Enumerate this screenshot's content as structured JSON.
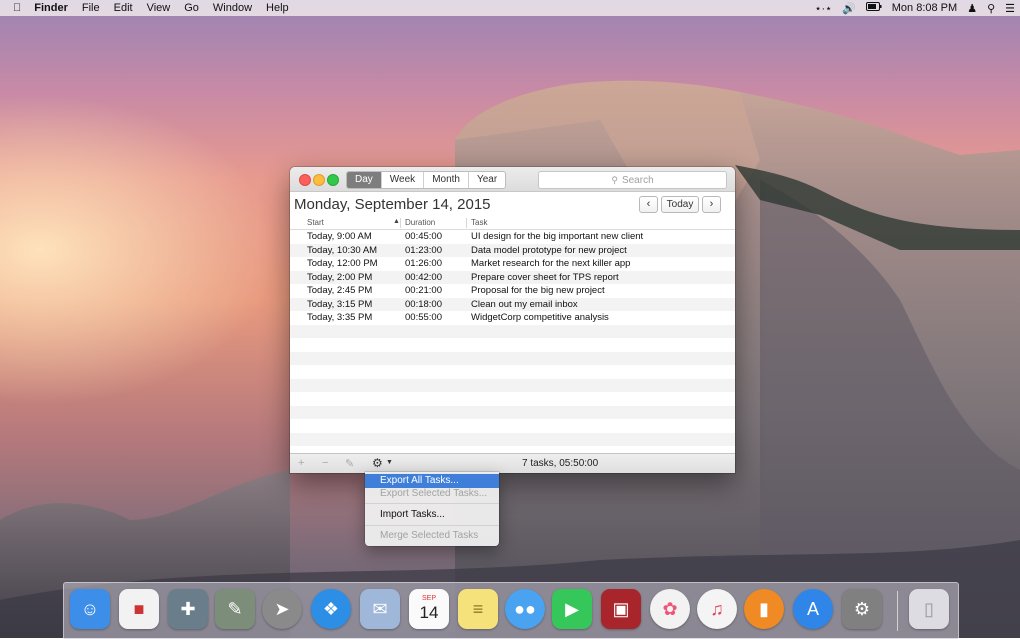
{
  "menubar": {
    "apple": "",
    "app": "Finder",
    "items": [
      "File",
      "Edit",
      "View",
      "Go",
      "Window",
      "Help"
    ],
    "clock": "Mon 8:08 PM",
    "status_icons": [
      "bluetooth-icon",
      "volume-icon",
      "battery-icon",
      "user-icon",
      "spotlight-icon",
      "notification-center-icon"
    ]
  },
  "window": {
    "tabs": [
      {
        "label": "Day",
        "active": true
      },
      {
        "label": "Week",
        "active": false
      },
      {
        "label": "Month",
        "active": false
      },
      {
        "label": "Year",
        "active": false
      }
    ],
    "search_placeholder": "Search",
    "date_title": "Monday, September 14, 2015",
    "today_label": "Today",
    "prev_label": "‹",
    "next_label": "›",
    "columns": {
      "start": "Start",
      "duration": "Duration",
      "task": "Task"
    },
    "rows": [
      {
        "start": "Today, 9:00 AM",
        "duration": "00:45:00",
        "task": "UI design for the big important new client"
      },
      {
        "start": "Today, 10:30 AM",
        "duration": "01:23:00",
        "task": "Data model prototype for new project"
      },
      {
        "start": "Today, 12:00 PM",
        "duration": "01:26:00",
        "task": "Market research for the next killer app"
      },
      {
        "start": "Today, 2:00 PM",
        "duration": "00:42:00",
        "task": "Prepare cover sheet for TPS report"
      },
      {
        "start": "Today, 2:45 PM",
        "duration": "00:21:00",
        "task": "Proposal for the big new project"
      },
      {
        "start": "Today, 3:15 PM",
        "duration": "00:18:00",
        "task": "Clean out my email inbox"
      },
      {
        "start": "Today, 3:35 PM",
        "duration": "00:55:00",
        "task": "WidgetCorp competitive analysis"
      }
    ],
    "status": "7 tasks, 05:50:00"
  },
  "menu": {
    "items": [
      {
        "label": "Export All Tasks...",
        "state": "highlighted"
      },
      {
        "label": "Export Selected Tasks...",
        "state": "disabled"
      },
      {
        "label": "Import Tasks...",
        "state": "enabled"
      },
      {
        "label": "Merge Selected Tasks",
        "state": "disabled"
      }
    ]
  },
  "dock": {
    "apps": [
      {
        "name": "finder-icon",
        "color": "#3d8ee8"
      },
      {
        "name": "calendar-icon",
        "color": "#f2f2f2"
      },
      {
        "name": "app-icon-3",
        "color": "#6a7d8a"
      },
      {
        "name": "app-icon-4",
        "color": "#7c8e7a"
      },
      {
        "name": "launchpad-icon",
        "color": "#8a8a8a"
      },
      {
        "name": "safari-icon",
        "color": "#2d8ee6"
      },
      {
        "name": "mail-icon",
        "color": "#9fb7d8"
      },
      {
        "name": "calendar-14-icon",
        "color": "#fafafa"
      },
      {
        "name": "notes-icon",
        "color": "#f6e27a"
      },
      {
        "name": "messages-icon",
        "color": "#4aa3f0"
      },
      {
        "name": "facetime-icon",
        "color": "#35c759"
      },
      {
        "name": "photo-booth-icon",
        "color": "#a8262b"
      },
      {
        "name": "photos-icon",
        "color": "#f2f2f2"
      },
      {
        "name": "itunes-icon",
        "color": "#f4f4f4"
      },
      {
        "name": "ibooks-icon",
        "color": "#f08a24"
      },
      {
        "name": "app-store-icon",
        "color": "#2f86e8"
      },
      {
        "name": "system-preferences-icon",
        "color": "#808080"
      }
    ],
    "calendar_month": "SEP",
    "calendar_day": "14",
    "trash": {
      "name": "trash-icon"
    }
  }
}
